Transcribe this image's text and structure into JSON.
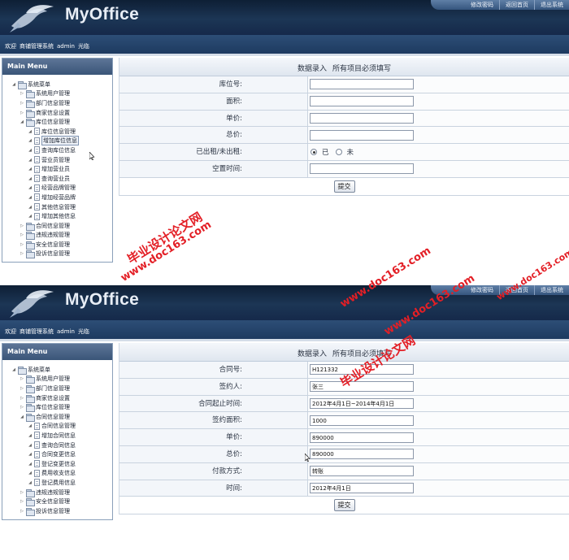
{
  "app": {
    "logo_text": "MyOffice",
    "top_links": [
      "修改密码",
      "返回首页",
      "退出系统"
    ],
    "welcome": [
      "欢迎",
      "商铺管理系统",
      "admin",
      "光临"
    ],
    "menu_title": "Main Menu",
    "submit_label": "提交"
  },
  "screens": [
    {
      "menu": [
        {
          "label": "系统菜单",
          "level": 0,
          "open": true,
          "type": "folder"
        },
        {
          "label": "系统用户管理",
          "level": 1,
          "open": false,
          "type": "folder"
        },
        {
          "label": "部门信息管理",
          "level": 1,
          "open": false,
          "type": "folder"
        },
        {
          "label": "商家信息设置",
          "level": 1,
          "open": false,
          "type": "folder"
        },
        {
          "label": "库位信息管理",
          "level": 1,
          "open": true,
          "type": "folder"
        },
        {
          "label": "库位信息管理",
          "level": 2,
          "open": false,
          "type": "doc"
        },
        {
          "label": "增加库位信息",
          "level": 2,
          "open": false,
          "type": "doc",
          "selected": true
        },
        {
          "label": "查询库位信息",
          "level": 2,
          "open": false,
          "type": "doc"
        },
        {
          "label": "营业员管理",
          "level": 2,
          "open": false,
          "type": "doc"
        },
        {
          "label": "增加营业员",
          "level": 2,
          "open": false,
          "type": "doc"
        },
        {
          "label": "查询营业员",
          "level": 2,
          "open": false,
          "type": "doc"
        },
        {
          "label": "经营品牌管理",
          "level": 2,
          "open": false,
          "type": "doc"
        },
        {
          "label": "增加经营品牌",
          "level": 2,
          "open": false,
          "type": "doc"
        },
        {
          "label": "其他信息管理",
          "level": 2,
          "open": false,
          "type": "doc"
        },
        {
          "label": "增加其他信息",
          "level": 2,
          "open": false,
          "type": "doc"
        },
        {
          "label": "合同信息管理",
          "level": 1,
          "open": false,
          "type": "folder"
        },
        {
          "label": "违规违规管理",
          "level": 1,
          "open": false,
          "type": "folder"
        },
        {
          "label": "安全信息管理",
          "level": 1,
          "open": false,
          "type": "folder"
        },
        {
          "label": "投诉信息管理",
          "level": 1,
          "open": false,
          "type": "folder"
        }
      ],
      "form_title": [
        "数据录入",
        "所有项目必须填写"
      ],
      "fields": [
        {
          "label": "库位号:",
          "kind": "text",
          "value": ""
        },
        {
          "label": "面积:",
          "kind": "text",
          "value": ""
        },
        {
          "label": "单价:",
          "kind": "text",
          "value": ""
        },
        {
          "label": "总价:",
          "kind": "text",
          "value": ""
        },
        {
          "label": "已出租/未出租:",
          "kind": "radio",
          "options": [
            {
              "label": "已",
              "checked": true
            },
            {
              "label": "未",
              "checked": false
            }
          ]
        },
        {
          "label": "空置时间:",
          "kind": "text",
          "value": ""
        }
      ]
    },
    {
      "menu": [
        {
          "label": "系统菜单",
          "level": 0,
          "open": true,
          "type": "folder"
        },
        {
          "label": "系统用户管理",
          "level": 1,
          "open": false,
          "type": "folder"
        },
        {
          "label": "部门信息管理",
          "level": 1,
          "open": false,
          "type": "folder"
        },
        {
          "label": "商家信息设置",
          "level": 1,
          "open": false,
          "type": "folder"
        },
        {
          "label": "库位信息管理",
          "level": 1,
          "open": false,
          "type": "folder"
        },
        {
          "label": "合同信息管理",
          "level": 1,
          "open": true,
          "type": "folder"
        },
        {
          "label": "合同信息管理",
          "level": 2,
          "open": false,
          "type": "doc"
        },
        {
          "label": "增加合同信息",
          "level": 2,
          "open": false,
          "type": "doc"
        },
        {
          "label": "查询合同信息",
          "level": 2,
          "open": false,
          "type": "doc"
        },
        {
          "label": "合同变更信息",
          "level": 2,
          "open": false,
          "type": "doc"
        },
        {
          "label": "登记变更信息",
          "level": 2,
          "open": false,
          "type": "doc"
        },
        {
          "label": "费用收支信息",
          "level": 2,
          "open": false,
          "type": "doc"
        },
        {
          "label": "登记费用信息",
          "level": 2,
          "open": false,
          "type": "doc"
        },
        {
          "label": "违规违规管理",
          "level": 1,
          "open": false,
          "type": "folder"
        },
        {
          "label": "安全信息管理",
          "level": 1,
          "open": false,
          "type": "folder"
        },
        {
          "label": "投诉信息管理",
          "level": 1,
          "open": false,
          "type": "folder"
        }
      ],
      "form_title": [
        "数据录入",
        "所有项目必须填写"
      ],
      "fields": [
        {
          "label": "合同号:",
          "kind": "text",
          "value": "H121332"
        },
        {
          "label": "签约人:",
          "kind": "text",
          "value": "张三"
        },
        {
          "label": "合同起止时间:",
          "kind": "text",
          "value": "2012年4月1日~2014年4月1日"
        },
        {
          "label": "签约面积:",
          "kind": "text",
          "value": "1000"
        },
        {
          "label": "单价:",
          "kind": "text",
          "value": "890000"
        },
        {
          "label": "总价:",
          "kind": "text",
          "value": "890000"
        },
        {
          "label": "付款方式:",
          "kind": "text",
          "value": "转账"
        },
        {
          "label": "时间:",
          "kind": "text",
          "value": "2012年4月1日"
        }
      ]
    }
  ],
  "watermarks": [
    "毕业设计论文网",
    "www.doc163.com"
  ],
  "colors": {
    "header": "#1c3655",
    "watermark": "#e31f26",
    "menu_bar": "#3a5578"
  }
}
